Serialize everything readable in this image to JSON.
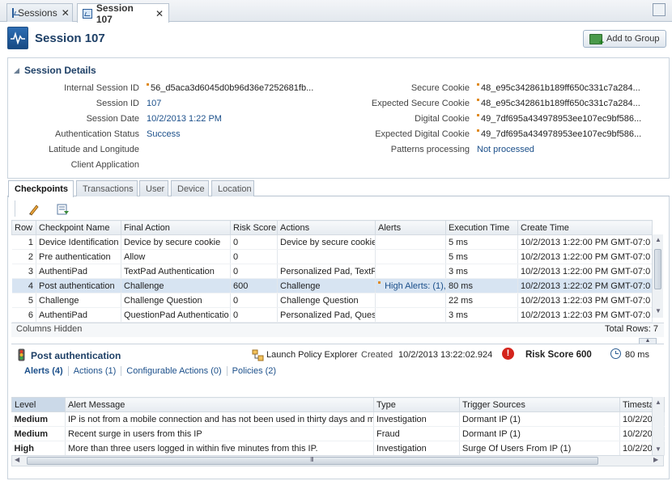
{
  "window": {
    "tabs": [
      {
        "label": "Sessions",
        "active": false
      },
      {
        "label": "Session 107",
        "active": true
      }
    ]
  },
  "header": {
    "title": "Session 107",
    "add_group_label": "Add to Group"
  },
  "session_details": {
    "heading": "Session Details",
    "left": [
      {
        "label": "Internal Session ID",
        "value": "56_d5aca3d6045d0b96d36e7252681fb..."
      },
      {
        "label": "Session ID",
        "value": "107"
      },
      {
        "label": "Session Date",
        "value": "10/2/2013 1:22 PM"
      },
      {
        "label": "Authentication Status",
        "value": "Success"
      },
      {
        "label": "Latitude and Longitude",
        "value": ""
      },
      {
        "label": "Client Application",
        "value": ""
      }
    ],
    "right": [
      {
        "label": "Secure Cookie",
        "value": "48_e95c342861b189ff650c331c7a284..."
      },
      {
        "label": "Expected Secure Cookie",
        "value": "48_e95c342861b189ff650c331c7a284..."
      },
      {
        "label": "Digital Cookie",
        "value": "49_7df695a434978953ee107ec9bf586..."
      },
      {
        "label": "Expected Digital Cookie",
        "value": "49_7df695a434978953ee107ec9bf586..."
      },
      {
        "label": "Patterns processing",
        "value": "Not processed"
      }
    ]
  },
  "tabs": [
    "Checkpoints",
    "Transactions",
    "User",
    "Device",
    "Location"
  ],
  "checkpoints": {
    "columns": [
      "Row",
      "Checkpoint Name",
      "Final Action",
      "Risk Score",
      "Actions",
      "Alerts",
      "Execution Time",
      "Create Time"
    ],
    "rows": [
      [
        "1",
        "Device Identification",
        "Device by secure cookie",
        "0",
        "Device by secure cookie",
        "",
        "5 ms",
        "10/2/2013 1:22:00 PM GMT-07:0"
      ],
      [
        "2",
        "Pre authentication",
        "Allow",
        "0",
        "",
        "",
        "5 ms",
        "10/2/2013 1:22:00 PM GMT-07:0"
      ],
      [
        "3",
        "AuthentiPad",
        "TextPad Authentication",
        "0",
        "Personalized Pad, TextPa",
        "",
        "3 ms",
        "10/2/2013 1:22:00 PM GMT-07:0"
      ],
      [
        "4",
        "Post authentication",
        "Challenge",
        "600",
        "Challenge",
        "High Alerts: (1),",
        "80 ms",
        "10/2/2013 1:22:02 PM GMT-07:0"
      ],
      [
        "5",
        "Challenge",
        "Challenge Question",
        "0",
        "Challenge Question",
        "",
        "22 ms",
        "10/2/2013 1:22:03 PM GMT-07:0"
      ],
      [
        "6",
        "AuthentiPad",
        "QuestionPad Authenticatio",
        "0",
        "Personalized Pad, Questi",
        "",
        "3 ms",
        "10/2/2013 1:22:03 PM GMT-07:0"
      ]
    ],
    "selected_row": 4,
    "columns_hidden": "Columns Hidden",
    "total_rows": "Total Rows: 7"
  },
  "post_auth": {
    "title": "Post authentication",
    "launch_label": "Launch Policy Explorer",
    "created_label": "Created",
    "created_value": "10/2/2013 13:22:02.924",
    "risk_label": "Risk Score 600",
    "time": "80 ms",
    "subtabs": [
      "Alerts (4)",
      "Actions (1)",
      "Configurable Actions (0)",
      "Policies (2)"
    ]
  },
  "alerts": {
    "columns": [
      "Level",
      "Alert Message",
      "Type",
      "Trigger Sources",
      "Timesta"
    ],
    "rows": [
      {
        "level": "Medium",
        "message": "IP is not from a mobile connection and has not been used in thirty days and mo",
        "type": "Investigation",
        "source": "Dormant IP (1)",
        "time": "10/2/20"
      },
      {
        "level": "Medium",
        "message": "Recent surge in users from this IP",
        "type": "Fraud",
        "source": "Dormant IP (1)",
        "time": "10/2/20"
      },
      {
        "level": "High",
        "message": "More than three users logged in within five minutes from this IP.",
        "type": "Investigation",
        "source": "Surge Of Users From IP (1)",
        "time": "10/2/20"
      }
    ]
  },
  "colors": {
    "accent": "#1d3f66",
    "link": "#1b4f8a",
    "medium": "#e59a12",
    "high": "#d41e1e"
  },
  "icons": [
    "session-icon",
    "close-icon",
    "add-group-icon",
    "edit-icon",
    "export-icon",
    "traffic-light-icon",
    "policy-explorer-icon",
    "alert-icon",
    "clock-icon"
  ]
}
